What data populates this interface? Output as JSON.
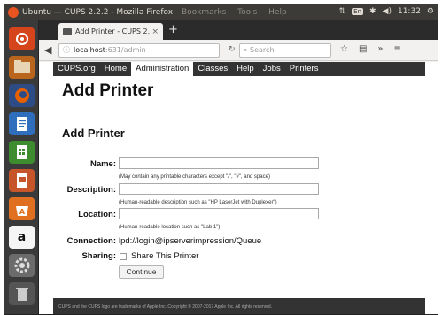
{
  "os": {
    "window_title": "Ubuntu — CUPS 2.2.2 - Mozilla Firefox",
    "menus": "Bookmarks Tools Help",
    "tray": {
      "keyboard": "En",
      "clock": "11:32"
    }
  },
  "launcher": {
    "items": [
      "dash-home",
      "files",
      "firefox",
      "writer",
      "calc",
      "impress",
      "software-center",
      "amazon",
      "settings",
      "trash"
    ],
    "amazon_glyph": "a"
  },
  "browser": {
    "tab_label": "Add Printer - CUPS 2...",
    "tab_close": "×",
    "new_tab": "+",
    "url_host": "localhost",
    "url_rest": ":631/admin",
    "search_placeholder": "Search"
  },
  "cups_nav": [
    "CUPS.org",
    "Home",
    "Administration",
    "Classes",
    "Help",
    "Jobs",
    "Printers"
  ],
  "cups_nav_active": "Administration",
  "page": {
    "title": "Add Printer",
    "section_title": "Add Printer",
    "name_label": "Name:",
    "name_hint": "(May contain any printable characters except \"/\", \"#\", and space)",
    "description_label": "Description:",
    "description_hint": "(Human-readable description such as \"HP LaserJet with Duplexer\")",
    "location_label": "Location:",
    "location_hint": "(Human-readable location such as \"Lab 1\")",
    "connection_label": "Connection:",
    "connection_value": "lpd://login@ipserverimpression/Queue",
    "sharing_label": "Sharing:",
    "sharing_option": "Share This Printer",
    "continue_label": "Continue",
    "footer": "CUPS and the CUPS logo are trademarks of Apple Inc. Copyright © 2007-2017 Apple Inc. All rights reserved."
  },
  "colors": {
    "ubuntu_orange": "#e95420",
    "cups_nav_bg": "#333333",
    "panel_bg": "#3c3b37"
  }
}
